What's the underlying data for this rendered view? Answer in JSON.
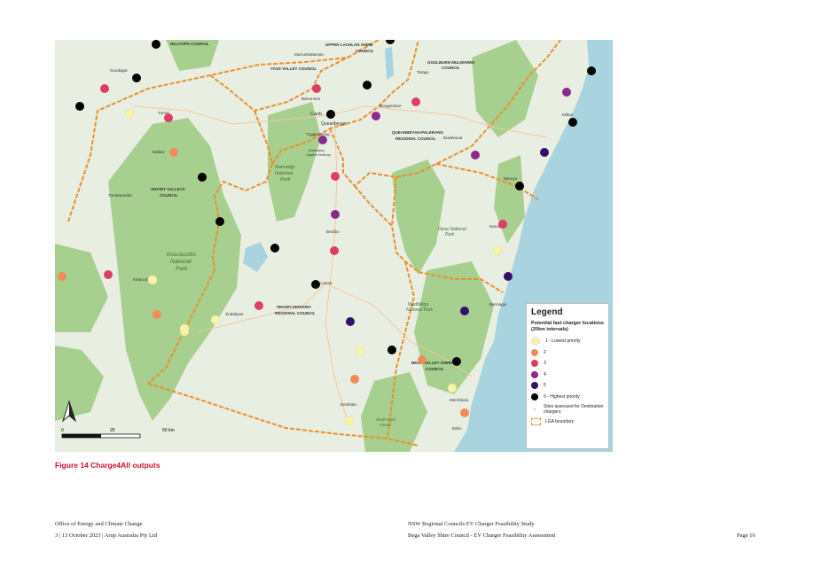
{
  "map": {
    "labels": {
      "hilltops": "HILLTOPS COUNCIL",
      "upper_lachlan": "UPPER LACHLAN SHIRE",
      "upper_lachlan_2": "COUNCIL",
      "goulburn": "GOULBURN MULWAREE",
      "goulburn_2": "COUNCIL",
      "yass": "YASS VALLEY COUNCIL",
      "qpr": "QUEANBEYAN-PALERANG",
      "qpr_2": "REGIONAL COUNCIL",
      "snowy_valleys": "SNOWY VALLEYS",
      "snowy_valleys_2": "COUNCIL",
      "snowy_monaro": "SNOWY MONARO",
      "snowy_monaro_2": "REGIONAL COUNCIL",
      "bega": "BEGA VALLEY SHIRE",
      "bega_2": "COUNCIL",
      "kosciuszko": "Kosciuszko",
      "kosciuszko_2": "National",
      "kosciuszko_3": "Park",
      "canberra": "Canb",
      "queanbeyan": "Queanbeyan",
      "gundagai": "Gundagai",
      "tumut": "Tumut",
      "tumbarumba": "Tumbarumba",
      "batlow": "Batlow",
      "cooma": "Cooma",
      "jindabyne": "Jindabyne",
      "khancoban": "Khancoban",
      "bredbo": "Bredbo",
      "bombala": "Bombala",
      "bungendore": "Bungendore",
      "braidwood": "Braidwood",
      "tarago": "Tarago",
      "moruya": "Moruya",
      "narooma": "Narooma",
      "bermagui": "Bermagui",
      "merimbula": "Merimbula",
      "eden": "Eden",
      "milton": "Milton",
      "murrumbateman": "Murrumbateman",
      "belconnen": "Belconnen",
      "tuggeranong": "Tuggeranong",
      "namadgi": "Namadgi",
      "namadgi_2": "National",
      "namadgi_3": "Park",
      "deua": "Deua National",
      "deua_2": "Park",
      "wadbilliga": "Wadbilliga",
      "wadbilliga_2": "National Park",
      "south_east_forest": "South East",
      "south_east_forest_2": "Forest",
      "act": "Australian",
      "act_2": "Capital Territory"
    },
    "scale": {
      "t0": "0",
      "t25": "25",
      "t50": "50 km"
    },
    "colors": {
      "p1": "#f7f4a5",
      "p2": "#f08c5a",
      "p3": "#dc3f63",
      "p4": "#8a2a8a",
      "p5": "#35106b",
      "p6": "#000000",
      "lga": "#e8912d",
      "ocean": "#a9d3de",
      "land": "#e9eee2",
      "park": "#a7cf8f"
    }
  },
  "legend": {
    "title": "Legend",
    "subtitle": "Potential fast charger locations (20km intervals)",
    "items": [
      {
        "label": "1 - Lowest priority",
        "color": "#f7f4a5"
      },
      {
        "label": "2",
        "color": "#f08c5a"
      },
      {
        "label": "3",
        "color": "#dc3f63"
      },
      {
        "label": "4",
        "color": "#8a2a8a"
      },
      {
        "label": "5",
        "color": "#35106b"
      },
      {
        "label": "6 - Highest priority",
        "color": "#000000"
      }
    ],
    "sites_label": "Sites assessed for Destination chargers",
    "lga_label": "LGA boundary"
  },
  "caption": "Figure 14  Charge4All outputs",
  "footer": {
    "left_line1": "Office of Energy and Climate Change",
    "left_line2": "3 | 13 October 2023 | Arup Australia Pty Ltd",
    "center_line1": "NSW Regional Councils EV Charger Feasibility Study",
    "center_line2": "Bega Valley Shire Council - EV Charger Feasibility Assessment",
    "page": "Page 16"
  }
}
